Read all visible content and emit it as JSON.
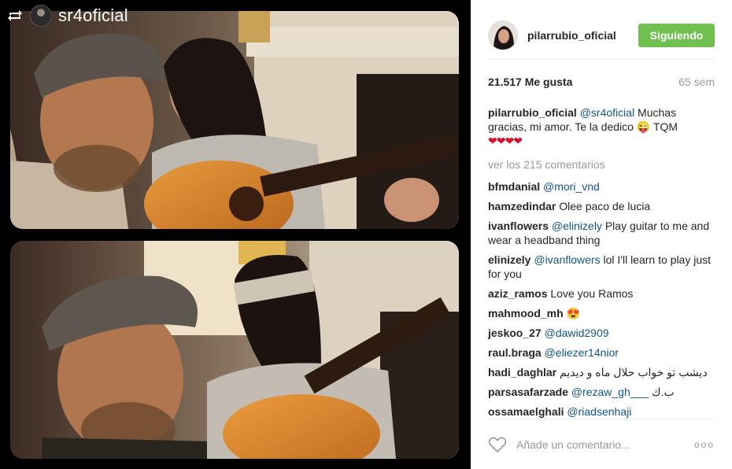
{
  "repost": {
    "icon": "repost-icon",
    "username": "sr4oficial"
  },
  "post": {
    "owner": "pilarrubio_oficial",
    "follow_label": "Siguiendo",
    "likes": "21.517 Me gusta",
    "time": "65 sem",
    "caption": {
      "user": "pilarrubio_oficial",
      "mention": "@sr4oficial",
      "text": " Muchas gracias, mi amor. Te la dedico ",
      "emoji": "😜",
      "after": " TQM",
      "hearts": "❤❤❤❤"
    },
    "view_all": "ver los 215 comentarios",
    "comments": [
      {
        "user": "bfmdanial",
        "mention": "@mori_vnd",
        "text": ""
      },
      {
        "user": "hamzedindar",
        "mention": "",
        "text": "Olee paco de lucia"
      },
      {
        "user": "ivanflowers",
        "mention": "@elinizely",
        "text": "Play guitar to me and wear a headband thing"
      },
      {
        "user": "elinizely",
        "mention": "@ivanflowers",
        "text": "lol I'll learn to play just for you"
      },
      {
        "user": "aziz_ramos",
        "mention": "",
        "text": "Love you Ramos"
      },
      {
        "user": "mahmood_mh",
        "mention": "",
        "text": "😍"
      },
      {
        "user": "jeskoo_27",
        "mention": "@dawid2909",
        "text": ""
      },
      {
        "user": "raul.braga",
        "mention": "@eliezer14nior",
        "text": ""
      },
      {
        "user": "hadi_daghlar",
        "mention": "",
        "text": "دیشب تو خواب حلال ماه و دیدیم"
      },
      {
        "user": "parsasafarzade",
        "mention": "@rezaw_gh___",
        "text": "ب.ك"
      },
      {
        "user": "ossamaelghali",
        "mention": "@riadsenhaji",
        "text": ""
      }
    ],
    "comment_placeholder": "Añade un comentario...",
    "more_label": "ooo"
  },
  "colors": {
    "follow_green": "#70c050",
    "mention_blue": "#125688",
    "muted_gray": "#999999",
    "heart_red": "#d8112b"
  }
}
